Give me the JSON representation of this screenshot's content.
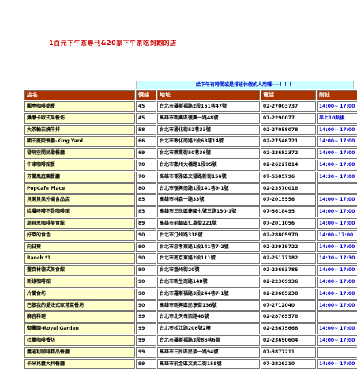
{
  "page_title": "1百元下午茶專刊&20家下午茶吃到飽的店",
  "banner": "給下午有時間或是排班休假的人用囉~~！！！",
  "headers": [
    "店名",
    "價錢",
    "地址",
    "電話",
    "附註"
  ],
  "rows": [
    {
      "name": "圓亭咖啡簡餐",
      "price": "45",
      "addr": "台北市羅斯福路2段151巷47號",
      "phone": "02-27003737",
      "note": "14:00~ 17:00"
    },
    {
      "name": "攝摩卡歐式早餐坊",
      "price": "45",
      "addr": "高雄市新興區復興一路48號",
      "phone": "07-2290077",
      "note": "早上10點後"
    },
    {
      "name": "大茶輪岩燒牛排",
      "price": "58",
      "addr": "台北市通化街52巷33號",
      "phone": "02-27058078",
      "note": "14:00~ 17:00"
    },
    {
      "name": "國王庭院餐廳-King Yard",
      "price": "66",
      "addr": "台北市敦化南路2段63巷14號",
      "phone": "02-27546721",
      "note": "14:00~ 17:00"
    },
    {
      "name": "發現空間民歌餐廳",
      "price": "69",
      "addr": "台北市樂業街50巷36號",
      "phone": "02-23682372",
      "note": "14:00~ 17:00"
    },
    {
      "name": "牛津咖啡館餐",
      "price": "70",
      "addr": "台北市鄭州大橋路1段95號",
      "phone": "02-26227814",
      "note": "14:00~ 17:00"
    },
    {
      "name": "芬蘭風庭園餐廳",
      "price": "70",
      "addr": "高雄市苓雅區文發路新街156號",
      "phone": "07-5585796",
      "note": "14:30~ 17:00"
    },
    {
      "name": "PopCafe Place",
      "price": "80",
      "addr": "台北市復興南路1段141巷9-1號",
      "phone": "02-23570018",
      "note": ""
    },
    {
      "name": "貝果貝果外國食品店",
      "price": "85",
      "addr": "高雄市林森一路33號",
      "phone": "07-2015556",
      "note": "14:00~ 17:00"
    },
    {
      "name": "哈囉哆嚟不是咖啡館",
      "price": "85",
      "addr": "高雄市三民區建國七號三路150-1號",
      "phone": "07-5618495",
      "note": "14:00~ 17:00"
    },
    {
      "name": "周貝思咖啡美食館",
      "price": "89",
      "addr": "高雄市前鎮區仁嘉街221號",
      "phone": "07-2011056",
      "note": "14:00~ 17:00"
    },
    {
      "name": "好萊的食色",
      "price": "90",
      "addr": "台北市汀州路318號",
      "phone": "02-28805970",
      "note": "14:00~17:00"
    },
    {
      "name": "向日葵",
      "price": "90",
      "addr": "台北市忠孝東路1段141巷7-2號",
      "phone": "02-23919722",
      "note": "14:00~ 17:00"
    },
    {
      "name": "Ranch *1",
      "price": "90",
      "addr": "台北市南京東路2段111號",
      "phone": "02-25177182",
      "note": "14:30~ 17:30"
    },
    {
      "name": "靈森林德式美食館",
      "price": "90",
      "addr": "台北市溫州街20號",
      "phone": "02-23693785",
      "note": "14:00~ 17:00"
    },
    {
      "name": "新綠咖啡館",
      "price": "90",
      "addr": "台北市新生南路148號",
      "phone": "02-22369936",
      "note": "14:00~ 17:00"
    },
    {
      "name": "片蘭食坊",
      "price": "90",
      "addr": "台北市羅斯福路3段244巷7-1號",
      "phone": "02-23685238",
      "note": "14:00~ 17:00"
    },
    {
      "name": "巴黎我的愛法式家常菜餐坊",
      "price": "90",
      "addr": "高雄市新興區民享街136號",
      "phone": "07-2712040",
      "note": "14:00~ 17:00"
    },
    {
      "name": "麻吉料理",
      "price": "99",
      "addr": "台北市北天母西路48號",
      "phone": "02-28765578",
      "note": ""
    },
    {
      "name": "御饗園-Royal Garden",
      "price": "99",
      "addr": "台北市松江路206號2樓",
      "phone": "02-25675668",
      "note": "14:00~ 17:00"
    },
    {
      "name": "杜麗咖啡餐坊",
      "price": "99",
      "addr": "台北市羅斯福路3段86巷6號",
      "phone": "02-23690604",
      "note": "14:00~ 17:00"
    },
    {
      "name": "義迪利咖啡精品餐廳",
      "price": "99",
      "addr": "高雄市三民區民族一路94號",
      "phone": "07-3877211",
      "note": ""
    },
    {
      "name": "卡米兒義大利餐廳",
      "price": "99",
      "addr": "高雄市前金區文武二街158號",
      "phone": "07-2826210",
      "note": "14:00~ 17:00"
    }
  ]
}
